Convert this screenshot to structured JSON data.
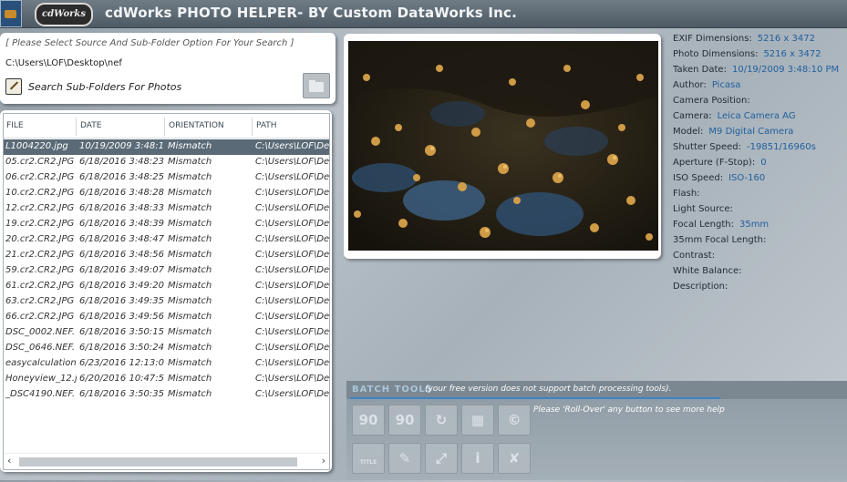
{
  "app": {
    "title": "cdWorks PHOTO HELPER- BY Custom DataWorks Inc.",
    "logo_text": "cdWorks"
  },
  "source": {
    "hint": "[ Please Select Source And Sub-Folder Option For Your Search ]",
    "path": "C:\\Users\\LOF\\Desktop\\nef",
    "subfolder_label": "Search Sub-Folders For Photos"
  },
  "list": {
    "headers": [
      "FILE",
      "DATE",
      "ORIENTATION",
      "PATH"
    ],
    "rows": [
      {
        "file": "L1004220.jpg",
        "date": "10/19/2009 3:48:1",
        "orientation": "Mismatch",
        "path": "C:\\Users\\LOF\\Des"
      },
      {
        "file": "05.cr2.CR2.JPG",
        "date": "6/18/2016 3:48:23",
        "orientation": "Mismatch",
        "path": "C:\\Users\\LOF\\Des"
      },
      {
        "file": "06.cr2.CR2.JPG",
        "date": "6/18/2016 3:48:25",
        "orientation": "Mismatch",
        "path": "C:\\Users\\LOF\\Des"
      },
      {
        "file": "10.cr2.CR2.JPG",
        "date": "6/18/2016 3:48:28",
        "orientation": "Mismatch",
        "path": "C:\\Users\\LOF\\Des"
      },
      {
        "file": "12.cr2.CR2.JPG",
        "date": "6/18/2016 3:48:33",
        "orientation": "Mismatch",
        "path": "C:\\Users\\LOF\\Des"
      },
      {
        "file": "19.cr2.CR2.JPG",
        "date": "6/18/2016 3:48:39",
        "orientation": "Mismatch",
        "path": "C:\\Users\\LOF\\Des"
      },
      {
        "file": "20.cr2.CR2.JPG",
        "date": "6/18/2016 3:48:47",
        "orientation": "Mismatch",
        "path": "C:\\Users\\LOF\\Des"
      },
      {
        "file": "21.cr2.CR2.JPG",
        "date": "6/18/2016 3:48:56",
        "orientation": "Mismatch",
        "path": "C:\\Users\\LOF\\Des"
      },
      {
        "file": "59.cr2.CR2.JPG",
        "date": "6/18/2016 3:49:07",
        "orientation": "Mismatch",
        "path": "C:\\Users\\LOF\\Des"
      },
      {
        "file": "61.cr2.CR2.JPG",
        "date": "6/18/2016 3:49:20",
        "orientation": "Mismatch",
        "path": "C:\\Users\\LOF\\Des"
      },
      {
        "file": "63.cr2.CR2.JPG",
        "date": "6/18/2016 3:49:35",
        "orientation": "Mismatch",
        "path": "C:\\Users\\LOF\\Des"
      },
      {
        "file": "66.cr2.CR2.JPG",
        "date": "6/18/2016 3:49:56",
        "orientation": "Mismatch",
        "path": "C:\\Users\\LOF\\Des"
      },
      {
        "file": "DSC_0002.NEF.",
        "date": "6/18/2016 3:50:15",
        "orientation": "Mismatch",
        "path": "C:\\Users\\LOF\\Des"
      },
      {
        "file": "DSC_0646.NEF.",
        "date": "6/18/2016 3:50:24",
        "orientation": "Mismatch",
        "path": "C:\\Users\\LOF\\Des"
      },
      {
        "file": "easycalculation",
        "date": "6/23/2016 12:13:0",
        "orientation": "Mismatch",
        "path": "C:\\Users\\LOF\\Des"
      },
      {
        "file": "Honeyview_12.j",
        "date": "6/20/2016 10:47:5",
        "orientation": "Mismatch",
        "path": "C:\\Users\\LOF\\Des"
      },
      {
        "file": "_DSC4190.NEF.",
        "date": "6/18/2016 3:50:35",
        "orientation": "Mismatch",
        "path": "C:\\Users\\LOF\\Des"
      }
    ],
    "selected_index": 0
  },
  "exif": [
    {
      "label": "EXIF Dimensions:",
      "value": "5216 x 3472"
    },
    {
      "label": "Photo Dimensions:",
      "value": "5216 x 3472"
    },
    {
      "label": "Taken Date:",
      "value": "10/19/2009 3:48:10 PM"
    },
    {
      "label": "Author:",
      "value": "Picasa"
    },
    {
      "label": "Camera Position:",
      "value": ""
    },
    {
      "label": "Camera:",
      "value": "Leica Camera AG"
    },
    {
      "label": "Model:",
      "value": "M9 Digital Camera"
    },
    {
      "label": "Shutter Speed:",
      "value": "-19851/16960s"
    },
    {
      "label": "Aperture (F-Stop):",
      "value": "0"
    },
    {
      "label": "ISO Speed:",
      "value": "ISO-160"
    },
    {
      "label": "Flash:",
      "value": ""
    },
    {
      "label": "Light Source:",
      "value": ""
    },
    {
      "label": "Focal Length:",
      "value": "35mm"
    },
    {
      "label": "35mm Focal Length:",
      "value": ""
    },
    {
      "label": "Contrast:",
      "value": ""
    },
    {
      "label": "White Balance:",
      "value": ""
    },
    {
      "label": "Description:",
      "value": ""
    }
  ],
  "batch": {
    "title": "BATCH TOOLS",
    "note": "(your free version does not support batch processing tools).",
    "hover_hint": "Please 'Roll-Over' any button to see more help",
    "tools": [
      {
        "name": "rotate-left-90-icon",
        "glyph": "90"
      },
      {
        "name": "rotate-right-90-icon",
        "glyph": "90"
      },
      {
        "name": "exif-rotate-icon",
        "glyph": "↻"
      },
      {
        "name": "calendar-icon",
        "glyph": "▦"
      },
      {
        "name": "watermark-icon",
        "glyph": "©"
      },
      {
        "name": "title-icon",
        "glyph": "TITLE"
      },
      {
        "name": "edit-icon",
        "glyph": "✎"
      },
      {
        "name": "fit-screen-icon",
        "glyph": "⤢"
      },
      {
        "name": "info-icon",
        "glyph": "i"
      },
      {
        "name": "exif-remove-icon",
        "glyph": "✘"
      }
    ]
  },
  "colors": {
    "accent": "#3d84c6",
    "selection": "#5a6a76",
    "exif_value": "#1e5f9e"
  }
}
